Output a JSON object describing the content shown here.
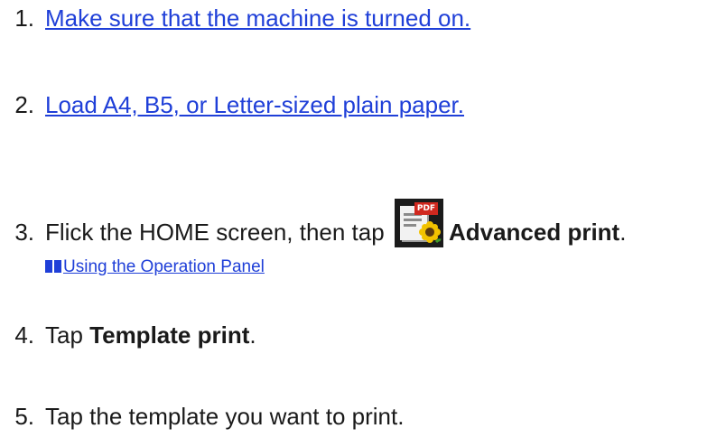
{
  "steps": [
    {
      "number": "1.",
      "text": "Make sure that the machine is turned on."
    },
    {
      "number": "2.",
      "text": "Load A4, B5, or Letter-sized plain paper."
    },
    {
      "number": "3.",
      "text_before": "Flick the HOME screen, then tap",
      "bold": "Advanced print",
      "text_after": "."
    },
    {
      "number": "4.",
      "text_before": "Tap",
      "bold": "Template print",
      "text_after": "."
    },
    {
      "number": "5.",
      "text": "Tap the template you want to print."
    }
  ],
  "related_link": {
    "text": "Using the Operation Panel",
    "icon": "link-arrow-icon"
  },
  "advanced_print_icon": {
    "icon": "advanced-print-app-icon",
    "badge": "PDF"
  },
  "colors": {
    "link": "#1f3fd8",
    "text": "#1a1a1a",
    "pdf_badge": "#d0281f"
  }
}
